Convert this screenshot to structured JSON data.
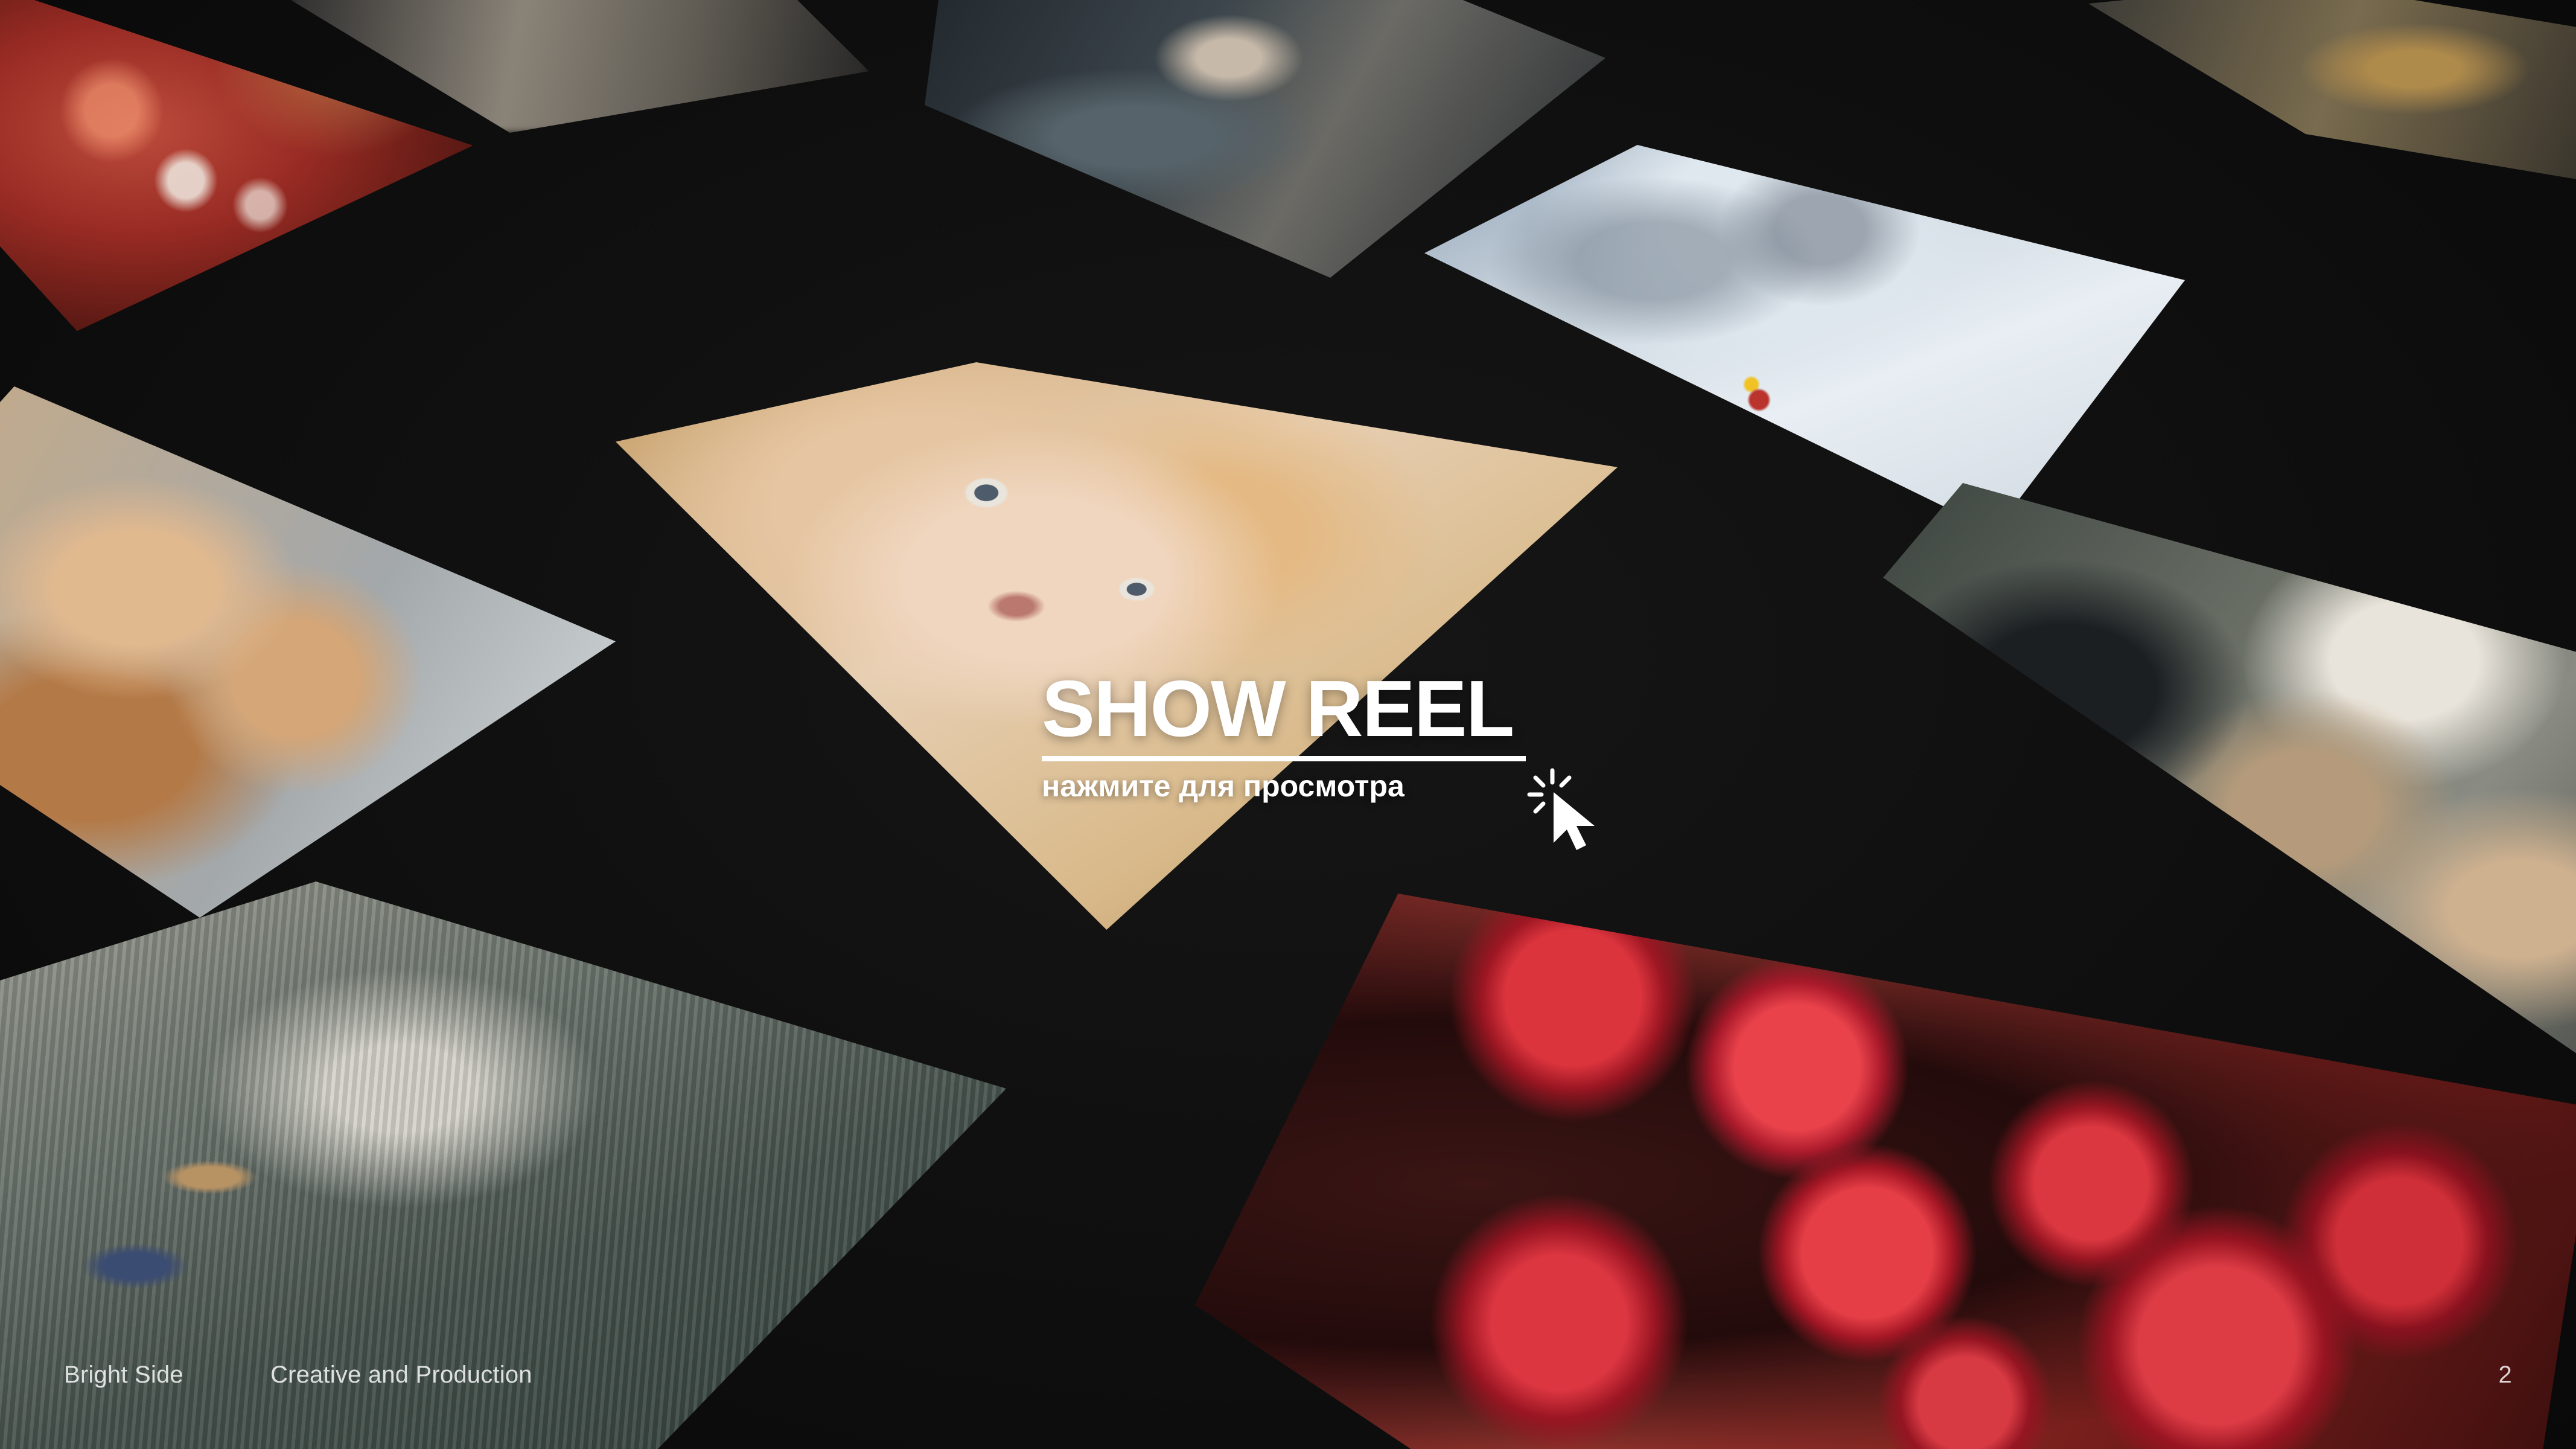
{
  "showreel": {
    "title": "SHOW REEL",
    "subtitle": "нажмите для просмотра"
  },
  "footer": {
    "brand": "Bright Side",
    "tagline": "Creative and Production",
    "page_number": "2"
  },
  "icons": {
    "cursor": "cursor-click-icon"
  },
  "colors": {
    "background": "#0f0f0f",
    "text": "#ffffff"
  }
}
